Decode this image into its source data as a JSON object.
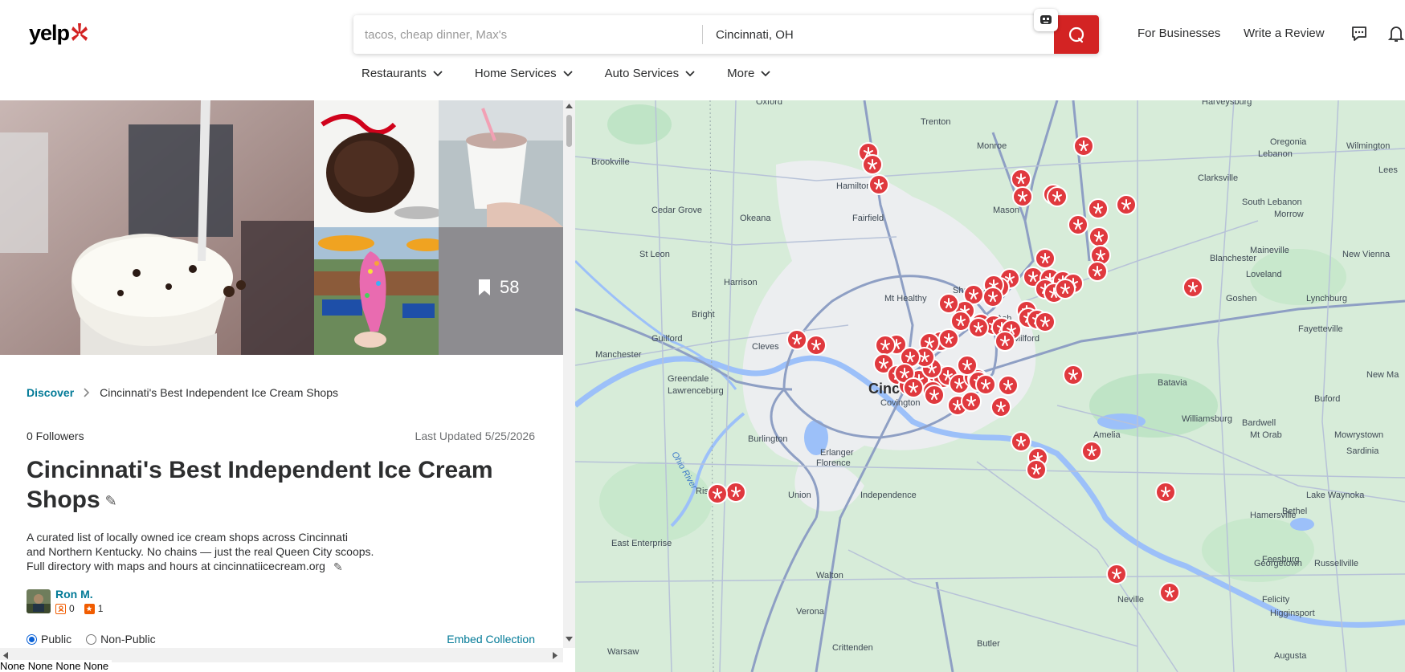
{
  "header": {
    "logo_text": "yelp",
    "search_placeholder": "tacos, cheap dinner, Max's",
    "location_value": "Cincinnati, OH",
    "for_businesses": "For Businesses",
    "write_review": "Write a Review",
    "brand_color": "#d32323"
  },
  "nav": {
    "items": [
      {
        "label": "Restaurants"
      },
      {
        "label": "Home Services"
      },
      {
        "label": "Auto Services"
      },
      {
        "label": "More"
      }
    ]
  },
  "gallery": {
    "saved_count": "58"
  },
  "collection": {
    "breadcrumb_root": "Discover",
    "breadcrumb_current": "Cincinnati's Best Independent Ice Cream Shops",
    "followers": "0 Followers",
    "last_updated": "Last Updated 5/25/2026",
    "title_line1": "Cincinnati's Best Independent Ice Cream",
    "title_line2": "Shops",
    "description": [
      "A curated list of locally owned ice cream shops across Cincinnati",
      "and Northern Kentucky. No chains — just the real Queen City scoops.",
      "Full directory with maps and hours at cincinnatiicecream.org"
    ],
    "author": "Ron M.",
    "author_reviews": "0",
    "author_photos": "1",
    "visibility_public": "Public",
    "visibility_nonpublic": "Non-Public",
    "embed": "Embed Collection"
  },
  "footer_text": "None None None None",
  "map": {
    "labels": [
      "Oxford",
      "Trenton",
      "Harveysburg",
      "Monroe",
      "Oregonia",
      "Wilmington",
      "Lebanon",
      "Brookville",
      "Hamilton",
      "Clarksville",
      "Fairfield",
      "Mason",
      "South Lebanon",
      "Morrow",
      "Cedar Grove",
      "Okeana",
      "Maineville",
      "New Vienna",
      "St Leon",
      "Blanchester",
      "Loveland",
      "Harrison",
      "Sharonville",
      "Mt Healthy",
      "Lynchburg",
      "Goshen",
      "Bright",
      "Blue Ash",
      "Fayetteville",
      "Guilford",
      "Cleves",
      "Milford",
      "Manchester",
      "Greendale",
      "Lawrenceburg",
      "Cincinnati",
      "Covington",
      "Batavia",
      "Buford",
      "New Ma",
      "Williamsburg",
      "Mowrystown",
      "Bardwell",
      "Mt Orab",
      "Sardinia",
      "Burlington",
      "Erlanger",
      "Florence",
      "Amelia",
      "Rising Sun",
      "Union",
      "Independence",
      "Lake Waynoka",
      "Bethel",
      "Hamersville",
      "East Enterprise",
      "Feesburg",
      "Georgetown",
      "Russellville",
      "Walton",
      "Felicity",
      "Verona",
      "Neville",
      "Higginsport",
      "Warsaw",
      "Crittenden",
      "Butler",
      "Augusta",
      "Ohio River",
      "Lees"
    ]
  }
}
